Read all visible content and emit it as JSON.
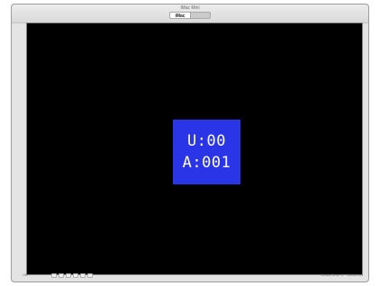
{
  "window": {
    "title": "iMac Mini"
  },
  "tabs": [
    {
      "label": "iMac"
    },
    {
      "label": ""
    }
  ],
  "osd": {
    "line1": "U:00",
    "line2": "A:001"
  },
  "status": {
    "left": "HD",
    "right": "Media Drive 8",
    "right2": "Media set"
  },
  "colors": {
    "viewport_bg": "#000000",
    "osd_bg": "#2a35e8",
    "osd_text": "#ffffff",
    "window_bg": "#e4e4e4"
  }
}
